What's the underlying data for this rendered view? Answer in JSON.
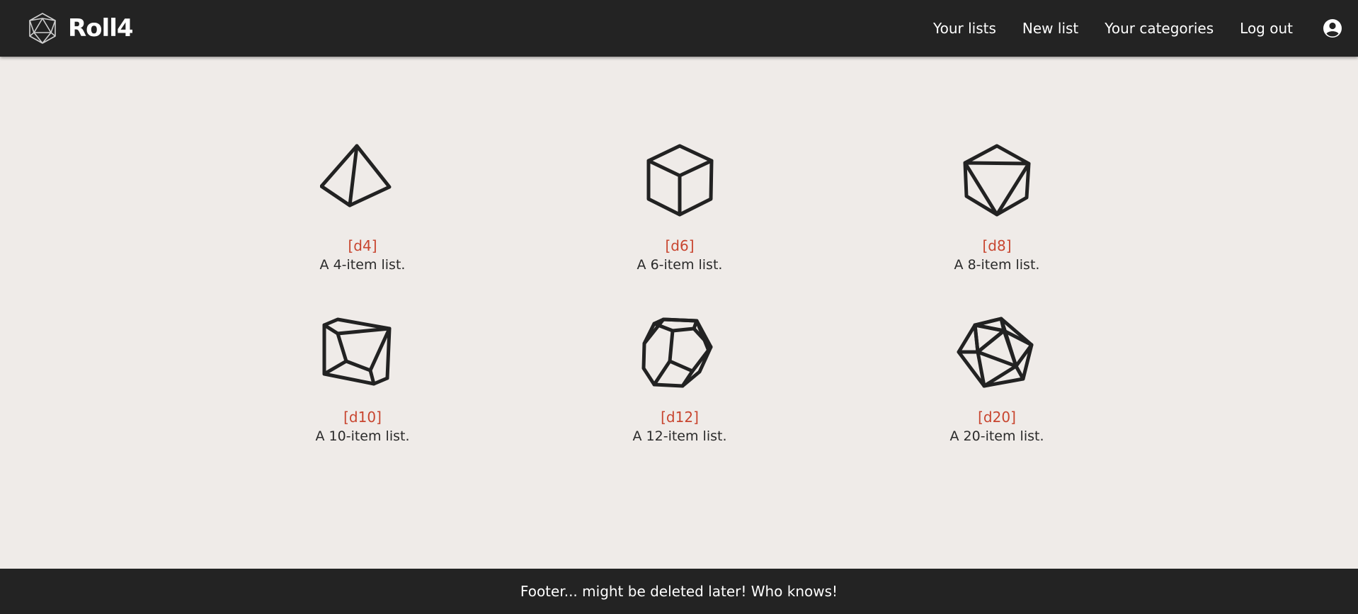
{
  "navbar": {
    "brand_name": "Roll4",
    "brand_icon": "d20-logo-icon",
    "links": [
      {
        "label": "Your lists"
      },
      {
        "label": "New list"
      },
      {
        "label": "Your categories"
      },
      {
        "label": "Log out"
      }
    ],
    "account_icon": "account-circle-icon"
  },
  "dice": [
    {
      "title": "[d4]",
      "description": "A 4-item list.",
      "icon": "d4-icon"
    },
    {
      "title": "[d6]",
      "description": "A 6-item list.",
      "icon": "d6-icon"
    },
    {
      "title": "[d8]",
      "description": "A 8-item list.",
      "icon": "d8-icon"
    },
    {
      "title": "[d10]",
      "description": "A 10-item list.",
      "icon": "d10-icon"
    },
    {
      "title": "[d12]",
      "description": "A 12-item list.",
      "icon": "d12-icon"
    },
    {
      "title": "[d20]",
      "description": "A 20-item list.",
      "icon": "d20-icon"
    }
  ],
  "footer": {
    "text": "Footer... might be deleted later! Who knows!"
  },
  "colors": {
    "navbar_bg": "#232323",
    "page_bg": "#efebe8",
    "accent": "#c8452f",
    "text": "#2a2a2a"
  }
}
